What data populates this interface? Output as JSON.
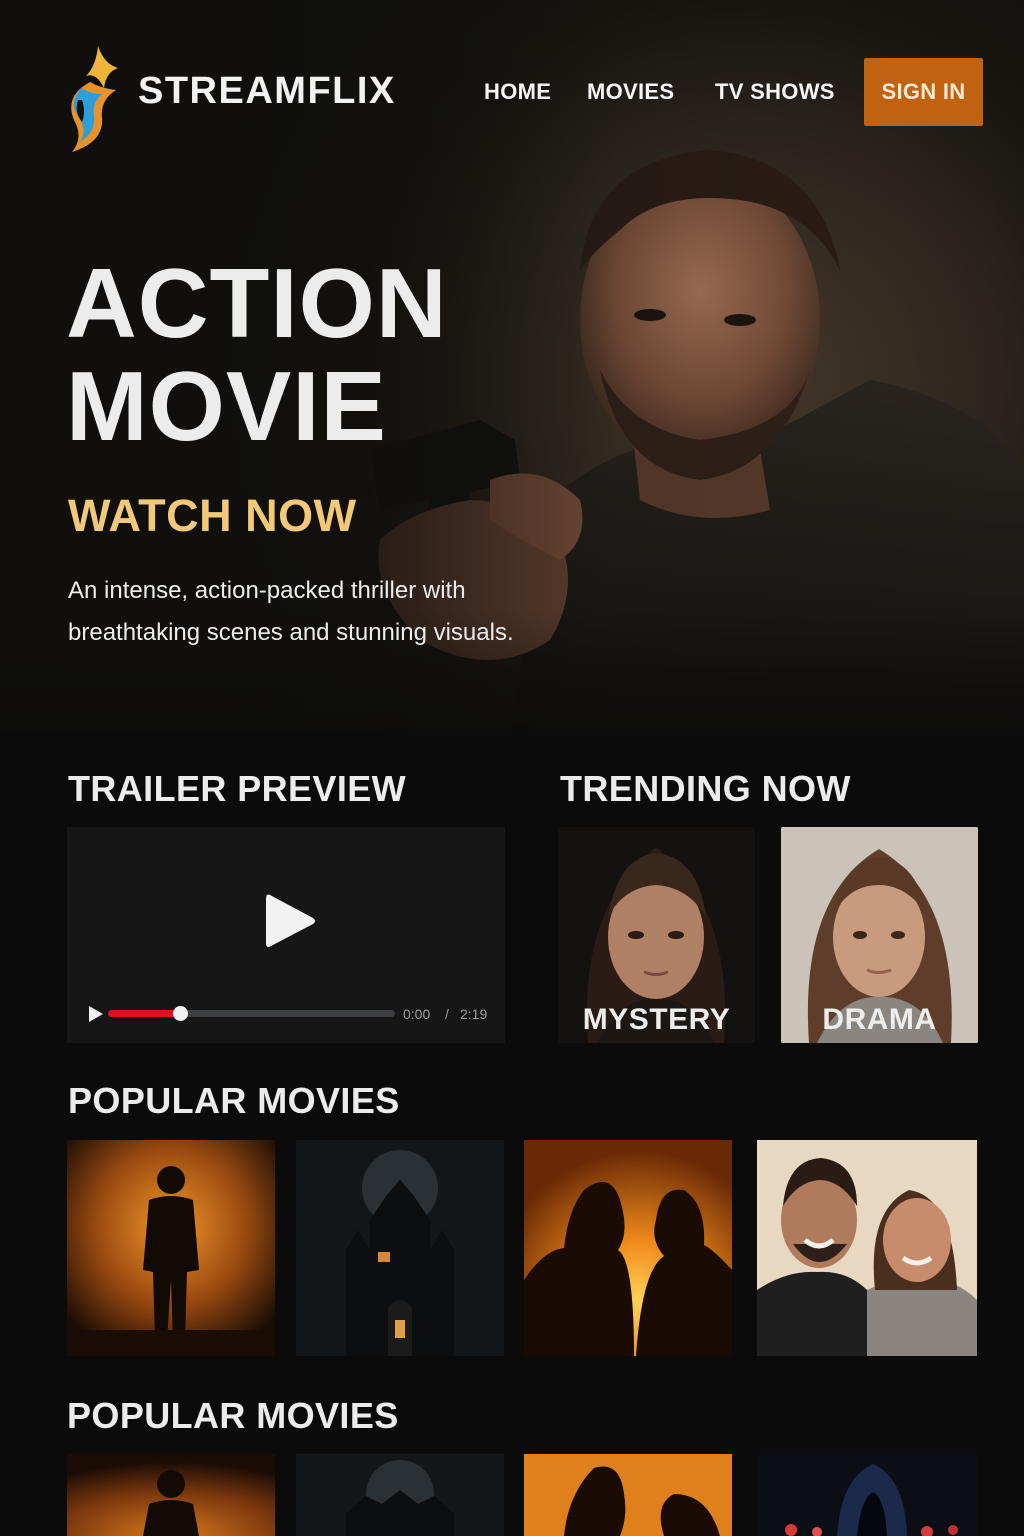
{
  "brand": {
    "name": "STREAMFLIX",
    "logo": "flame-s-logo-icon"
  },
  "nav": {
    "items": [
      {
        "label": "HOME"
      },
      {
        "label": "MOVIES"
      },
      {
        "label": "TV SHOWS"
      }
    ],
    "signin_label": "SIGN IN"
  },
  "hero": {
    "title_line1": "ACTION",
    "title_line2": "MOVIE",
    "cta": "WATCH NOW",
    "description": "An intense, action-packed thriller with breathtaking scenes and stunning visuals."
  },
  "trailer": {
    "heading": "TRAILER PREVIEW",
    "current_time": "0:00",
    "separator": "/",
    "duration": "2:19",
    "progress": 0.25
  },
  "trending": {
    "heading": "TRENDING NOW",
    "items": [
      {
        "label": "MYSTERY"
      },
      {
        "label": "DRAMA"
      }
    ]
  },
  "popular": [
    {
      "heading": "POPULAR MOVIES"
    },
    {
      "heading": "POPULAR MOVIES"
    }
  ],
  "colors": {
    "accent": "#c0620f",
    "watch_now": "#f1c978",
    "progress": "#d8141c",
    "background": "#0b0b0b"
  }
}
